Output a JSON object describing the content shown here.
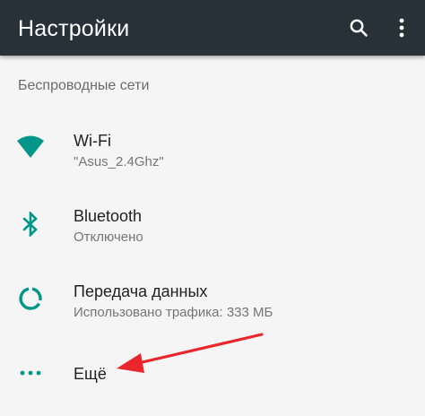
{
  "appbar": {
    "title": "Настройки",
    "search_icon": "search-icon",
    "more_icon": "more-vert-icon",
    "background": "#263238"
  },
  "section": {
    "header": "Беспроводные сети"
  },
  "items": [
    {
      "title": "Wi-Fi",
      "subtitle": "\"Asus_2.4Ghz\"",
      "icon": "wifi-icon"
    },
    {
      "title": "Bluetooth",
      "subtitle": "Отключено",
      "icon": "bluetooth-icon"
    },
    {
      "title": "Передача данных",
      "subtitle": "Использовано трафика: 333 МБ",
      "icon": "data-usage-icon"
    },
    {
      "title": "Ещё",
      "subtitle": "",
      "icon": "more-horiz-icon"
    }
  ],
  "colors": {
    "accent": "#009688",
    "annotation_arrow": "#e8262b"
  }
}
